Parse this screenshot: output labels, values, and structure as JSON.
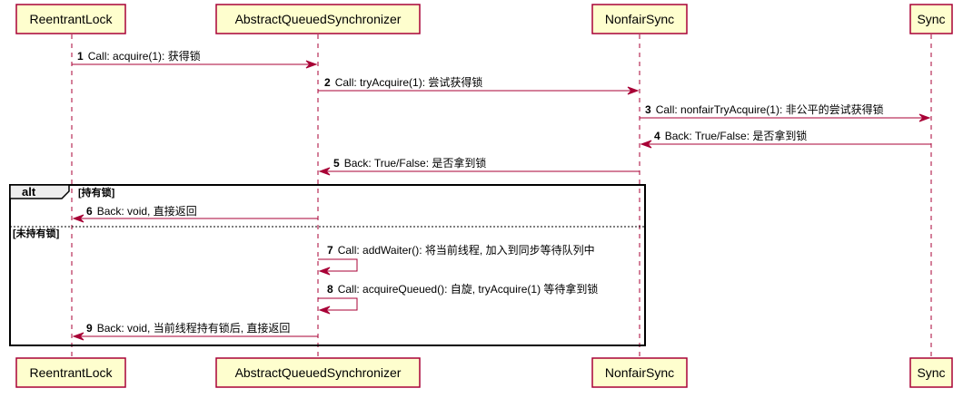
{
  "participants": [
    {
      "id": "rl",
      "label": "ReentrantLock"
    },
    {
      "id": "aqs",
      "label": "AbstractQueuedSynchronizer"
    },
    {
      "id": "nfs",
      "label": "NonfairSync"
    },
    {
      "id": "sync",
      "label": "Sync"
    }
  ],
  "messages": [
    {
      "num": "1",
      "text": "Call: acquire(1): 获得锁",
      "from": "rl",
      "to": "aqs"
    },
    {
      "num": "2",
      "text": "Call: tryAcquire(1): 尝试获得锁",
      "from": "aqs",
      "to": "nfs"
    },
    {
      "num": "3",
      "text": "Call: nonfairTryAcquire(1): 非公平的尝试获得锁",
      "from": "nfs",
      "to": "sync"
    },
    {
      "num": "4",
      "text": "Back: True/False: 是否拿到锁",
      "from": "sync",
      "to": "nfs"
    },
    {
      "num": "5",
      "text": "Back: True/False: 是否拿到锁",
      "from": "nfs",
      "to": "aqs"
    },
    {
      "num": "6",
      "text": "Back: void, 直接返回",
      "from": "aqs",
      "to": "rl"
    },
    {
      "num": "7",
      "text": "Call: addWaiter(): 将当前线程, 加入到同步等待队列中",
      "from": "aqs",
      "to": "aqs"
    },
    {
      "num": "8",
      "text": "Call: acquireQueued(): 自旋, tryAcquire(1) 等待拿到锁",
      "from": "aqs",
      "to": "aqs"
    },
    {
      "num": "9",
      "text": "Back: void, 当前线程持有锁后, 直接返回",
      "from": "aqs",
      "to": "rl"
    }
  ],
  "alt": {
    "label": "alt",
    "guard1": "[持有锁]",
    "guard2": "[未持有锁]"
  },
  "colors": {
    "participant_fill": "#FEFECE",
    "participant_border": "#A80036",
    "arrow": "#A80036"
  }
}
